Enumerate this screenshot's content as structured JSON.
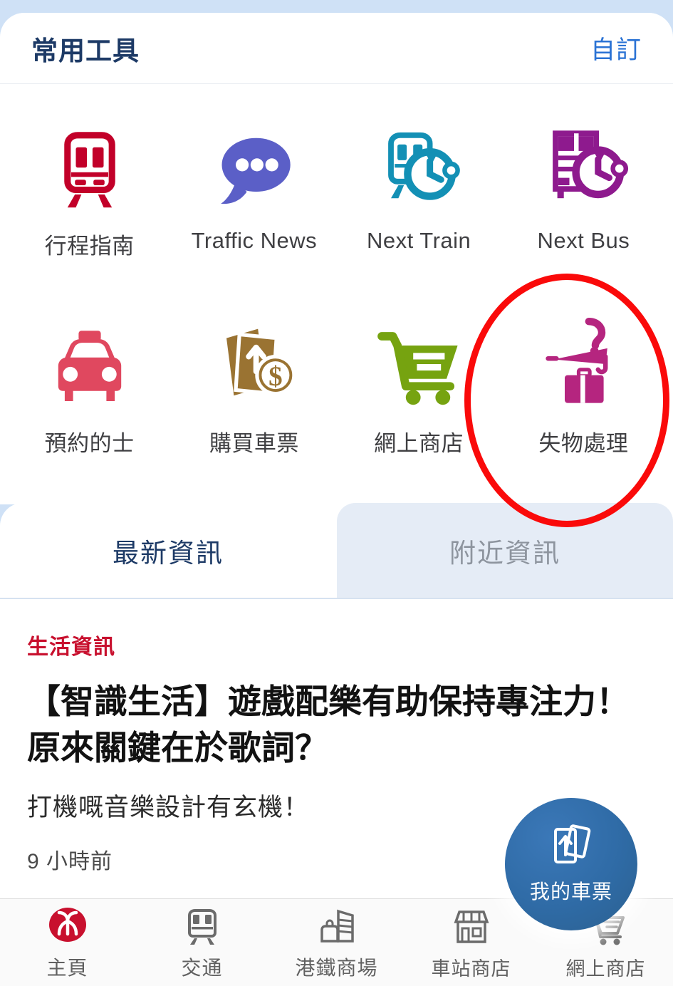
{
  "theme": {
    "page_bg": "#cfe1f6",
    "card_bg": "#ffffff",
    "title_color": "#1d3a66",
    "link_color": "#2a72d4",
    "annotation_color": "#fa0a0a",
    "category_color": "#c8102e",
    "fab_color": "#2f6ba6",
    "inactive_tab_bg": "#e5ecf6"
  },
  "tools_panel": {
    "title": "常用工具",
    "customize_label": "自訂",
    "items": [
      {
        "label": "行程指南",
        "icon": "train-front-icon",
        "color": "#c20029"
      },
      {
        "label": "Traffic News",
        "icon": "speech-bubble-icon",
        "color": "#5b5fc7"
      },
      {
        "label": "Next Train",
        "icon": "train-clock-icon",
        "color": "#1390b5"
      },
      {
        "label": "Next Bus",
        "icon": "bus-clock-icon",
        "color": "#8e1a8e"
      },
      {
        "label": "預約的士",
        "icon": "taxi-icon",
        "color": "#e0485f"
      },
      {
        "label": "購買車票",
        "icon": "ticket-dollar-icon",
        "color": "#9a7332"
      },
      {
        "label": "網上商店",
        "icon": "shopping-cart-icon",
        "color": "#76a310"
      },
      {
        "label": "失物處理",
        "icon": "umbrella-suitcase-question-icon",
        "color": "#b5257f"
      }
    ],
    "highlighted_item": "失物處理"
  },
  "tabs": [
    {
      "label": "最新資訊",
      "active": true
    },
    {
      "label": "附近資訊",
      "active": false
    }
  ],
  "news": {
    "category": "生活資訊",
    "title": "【智識生活】遊戲配樂有助保持專注力！原來關鍵在於歌詞？",
    "subtitle": "打機嘅音樂設計有玄機！",
    "timestamp": "9 小時前"
  },
  "fab": {
    "label": "我的車票",
    "icon": "tickets-up-arrow-icon"
  },
  "bottom_nav": [
    {
      "label": "主頁",
      "icon": "mtr-logo-icon",
      "active": true
    },
    {
      "label": "交通",
      "icon": "train-front-outline-icon",
      "active": false
    },
    {
      "label": "港鐵商場",
      "icon": "mall-building-icon",
      "active": false
    },
    {
      "label": "車站商店",
      "icon": "storefront-icon",
      "active": false
    },
    {
      "label": "網上商店",
      "icon": "cart-outline-icon",
      "active": false
    }
  ]
}
